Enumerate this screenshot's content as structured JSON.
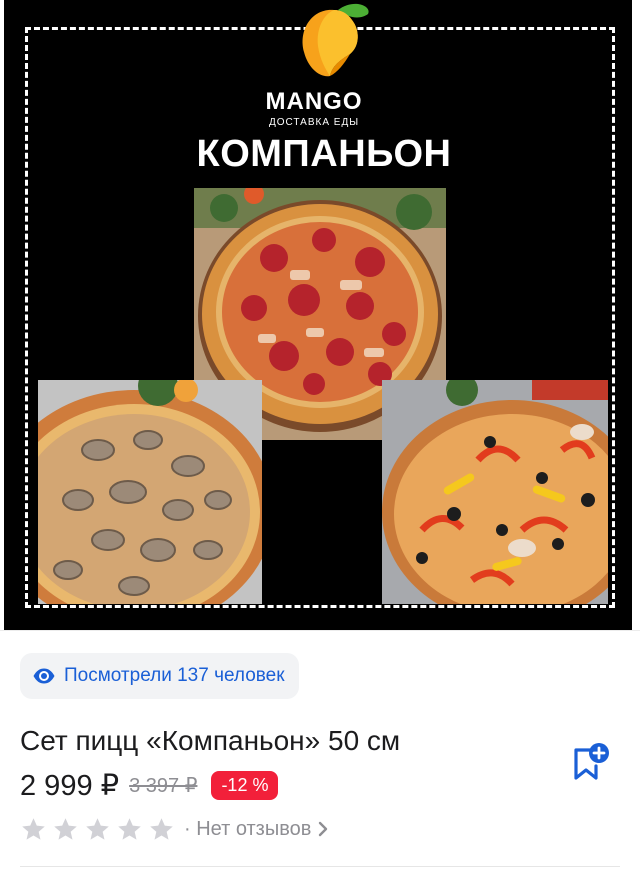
{
  "banner": {
    "brand": "MANGO",
    "brand_subtitle": "ДОСТАВКА ЕДЫ",
    "set_title": "КОМПАНЬОН",
    "logo_icon": "mango-logo-icon",
    "photos": [
      "pepperoni-pizza",
      "mushroom-pizza",
      "capricciosa-pizza"
    ]
  },
  "views": {
    "icon": "eye-icon",
    "text": "Посмотрели 137 человек"
  },
  "product": {
    "name": "Сет пицц «Компаньон» 50 см",
    "price_current": "2 999 ₽",
    "price_old": "3 397 ₽",
    "discount": "-12 %"
  },
  "rating": {
    "stars_filled": 0,
    "stars_total": 5,
    "reviews_text": "· Нет отзывов"
  },
  "actions": {
    "favorite_icon": "bookmark-add-icon"
  },
  "colors": {
    "accent_blue": "#1a5fd6",
    "discount_red": "#f2203a",
    "muted_gray": "#8e8e93",
    "star_gray": "#d1d1d6",
    "banner_black": "#000000"
  }
}
